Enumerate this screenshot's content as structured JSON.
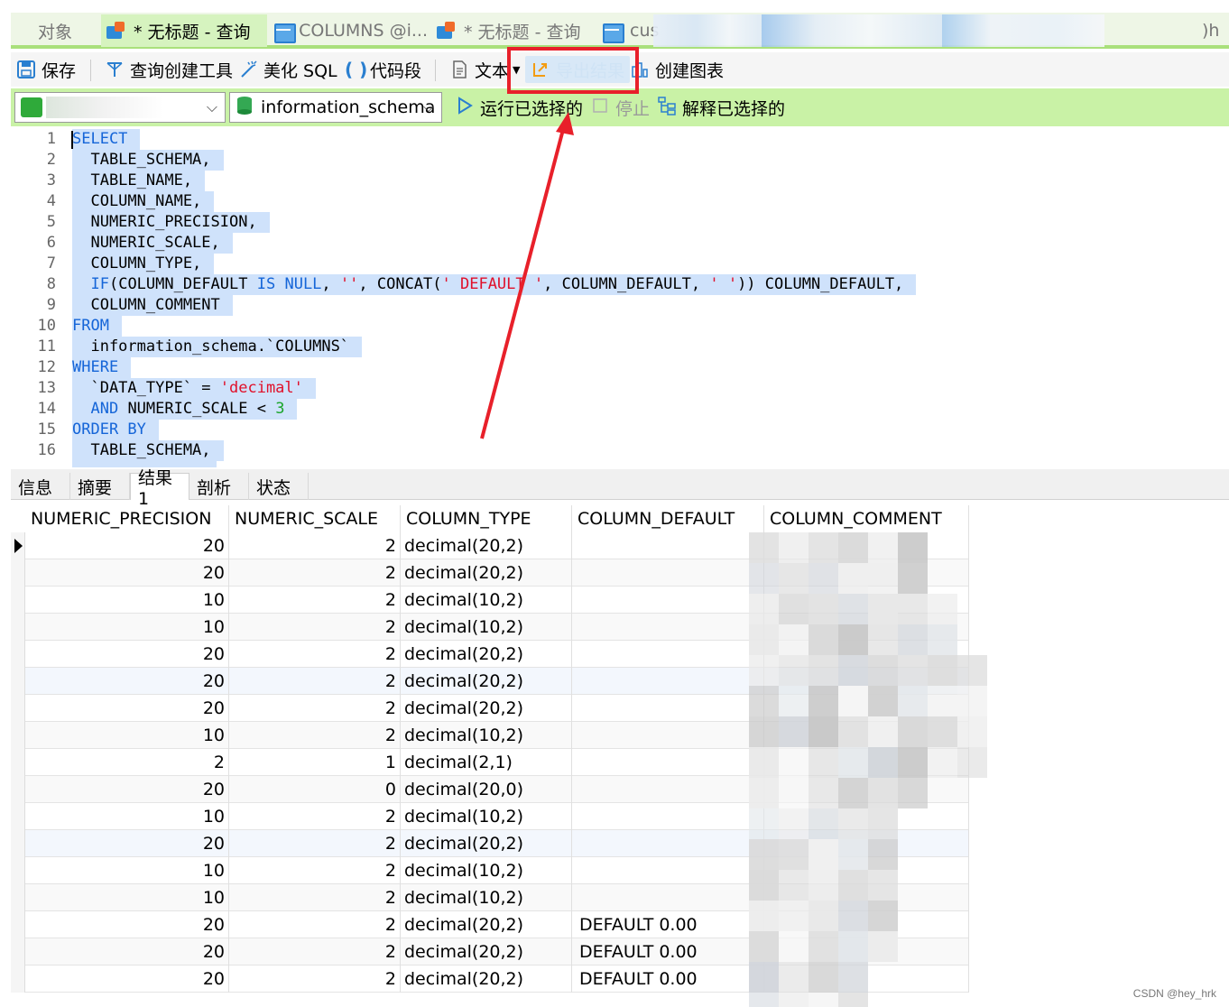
{
  "tabs": [
    {
      "label": "对象",
      "icon": "none",
      "active": false
    },
    {
      "label": "* 无标题 - 查询",
      "icon": "query-icon",
      "active": true
    },
    {
      "label": "COLUMNS @i...",
      "icon": "table-icon",
      "active": false
    },
    {
      "label": "* 无标题 - 查询",
      "icon": "query-icon",
      "active": false
    },
    {
      "label": "cus",
      "icon": "table-icon",
      "active": false
    },
    {
      "label": ")h",
      "icon": "none",
      "active": false
    }
  ],
  "toolbar": {
    "save": "保存",
    "query_builder": "查询创建工具",
    "beautify": "美化 SQL",
    "snippet": "代码段",
    "text": "文本",
    "export": "导出结果",
    "chart": "创建图表"
  },
  "connbar": {
    "database": "information_schema",
    "run_selected": "运行已选择的",
    "stop": "停止",
    "explain_selected": "解释已选择的"
  },
  "editor": {
    "line_numbers": [
      "1",
      "2",
      "3",
      "4",
      "5",
      "6",
      "7",
      "8",
      "9",
      "10",
      "11",
      "12",
      "13",
      "14",
      "15",
      "16"
    ]
  },
  "result_tabs": [
    "信息",
    "摘要",
    "结果 1",
    "剖析",
    "状态"
  ],
  "grid": {
    "columns": [
      "NUMERIC_PRECISION",
      "NUMERIC_SCALE",
      "COLUMN_TYPE",
      "COLUMN_DEFAULT",
      "COLUMN_COMMENT"
    ],
    "rows": [
      [
        "20",
        "2",
        "decimal(20,2)",
        ""
      ],
      [
        "20",
        "2",
        "decimal(20,2)",
        ""
      ],
      [
        "10",
        "2",
        "decimal(10,2)",
        ""
      ],
      [
        "10",
        "2",
        "decimal(10,2)",
        ""
      ],
      [
        "20",
        "2",
        "decimal(20,2)",
        ""
      ],
      [
        "20",
        "2",
        "decimal(20,2)",
        ""
      ],
      [
        "20",
        "2",
        "decimal(20,2)",
        ""
      ],
      [
        "10",
        "2",
        "decimal(10,2)",
        ""
      ],
      [
        "2",
        "1",
        "decimal(2,1)",
        ""
      ],
      [
        "20",
        "0",
        "decimal(20,0)",
        ""
      ],
      [
        "10",
        "2",
        "decimal(10,2)",
        ""
      ],
      [
        "20",
        "2",
        "decimal(20,2)",
        ""
      ],
      [
        "10",
        "2",
        "decimal(10,2)",
        ""
      ],
      [
        "10",
        "2",
        "decimal(10,2)",
        ""
      ],
      [
        "20",
        "2",
        "decimal(20,2)",
        "DEFAULT 0.00"
      ],
      [
        "20",
        "2",
        "decimal(20,2)",
        "DEFAULT 0.00"
      ],
      [
        "20",
        "2",
        "decimal(20,2)",
        "DEFAULT 0.00"
      ]
    ]
  },
  "watermark": "CSDN @hey_hrk",
  "colors": {
    "accent_green": "#a9e07b",
    "connbar_bg": "#c9f2a6",
    "selection": "#cfe2fb",
    "keyword": "#1565d8",
    "string": "#e0102a",
    "number": "#1aa52a",
    "annotation_red": "#e8202a"
  }
}
